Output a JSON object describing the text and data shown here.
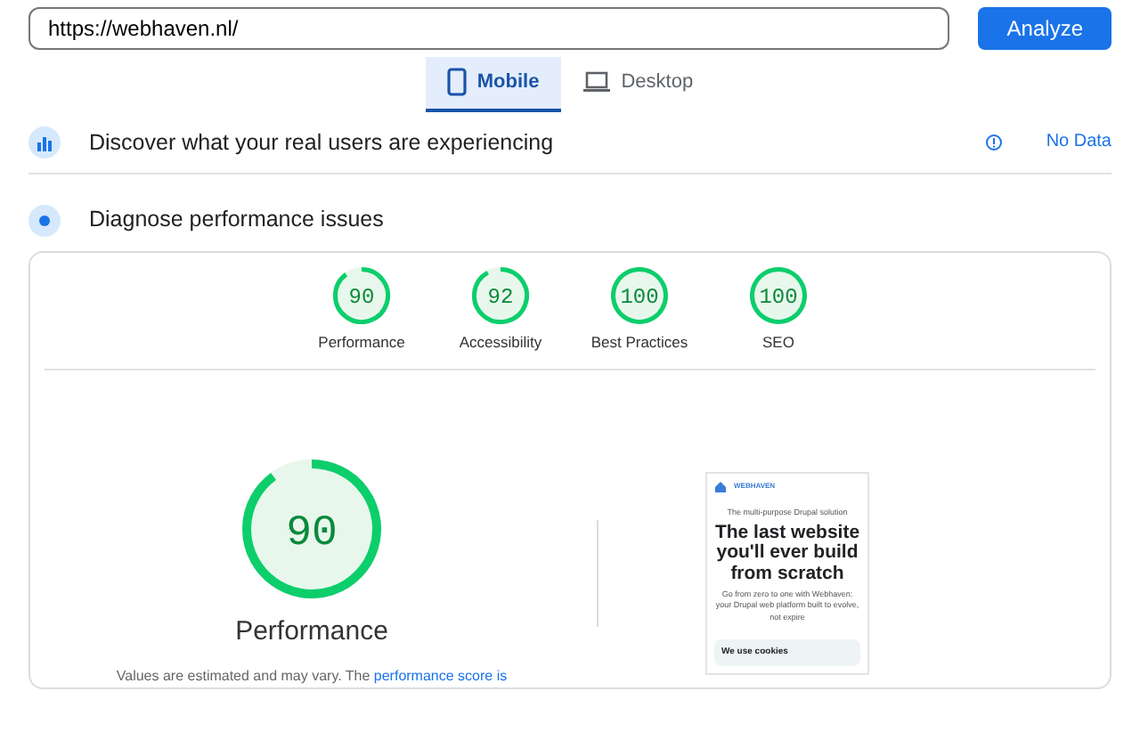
{
  "url_field": {
    "value": "https://webhaven.nl/"
  },
  "analyze_button": {
    "label": "Analyze"
  },
  "device_tabs": [
    {
      "label": "Mobile",
      "kind": "phone",
      "selected": true
    },
    {
      "label": "Desktop",
      "kind": "laptop",
      "selected": false
    }
  ],
  "field_data": {
    "title": "Discover what your real users are experiencing",
    "status": "No Data"
  },
  "lab_data": {
    "title": "Diagnose performance issues"
  },
  "categories": [
    {
      "score": "90",
      "label": "Performance",
      "level": 0.9
    },
    {
      "score": "92",
      "label": "Accessibility",
      "level": 0.92
    },
    {
      "score": "100",
      "label": "Best Practices",
      "level": 1
    },
    {
      "score": "100",
      "label": "SEO",
      "level": 1
    }
  ],
  "main_gauge": {
    "score": "90",
    "label": "Performance",
    "level": 0.9,
    "note": "Values are estimated and may vary. The",
    "note_link": "performance score is"
  },
  "page_screenshot": {
    "logo": "WEBHAVEN",
    "tag": "The multi-purpose Drupal solution",
    "headline": "The last website you'll ever build from scratch",
    "subtitle": "Go from zero to one with Webhaven: your Drupal web platform built to evolve, not expire",
    "cookie_title": "We use cookies"
  }
}
